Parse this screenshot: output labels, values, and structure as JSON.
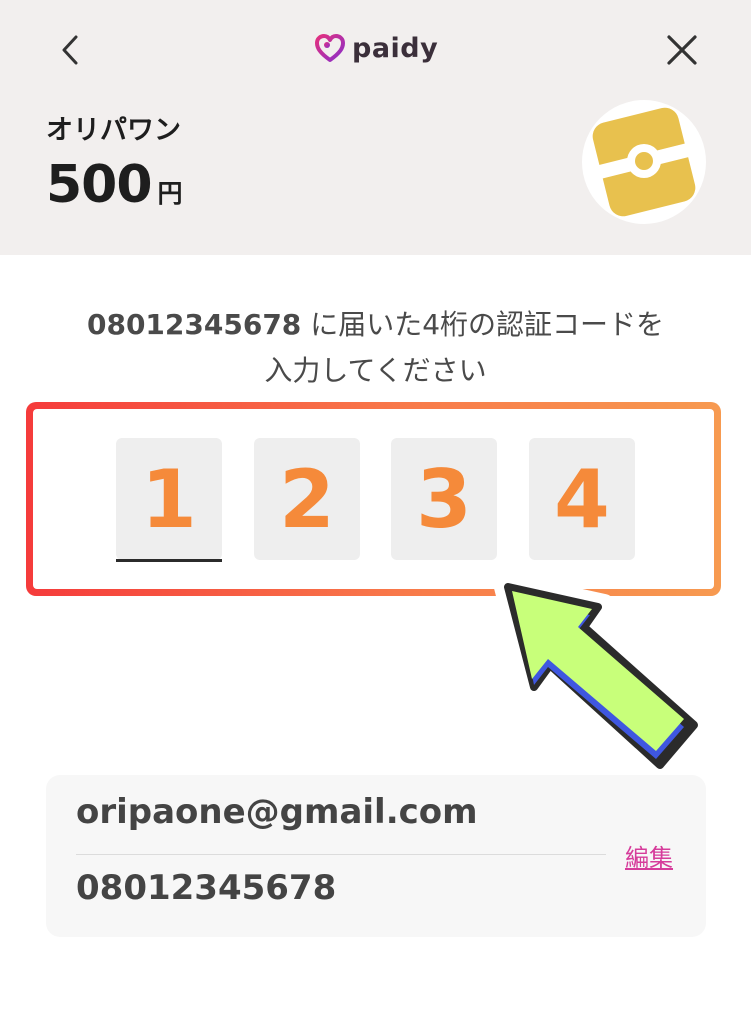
{
  "header": {
    "brand": "paidy",
    "merchant_name": "オリパワン",
    "amount": "500",
    "currency": "円",
    "back_icon": "chevron-left-icon",
    "close_icon": "close-icon"
  },
  "verification": {
    "phone": "08012345678",
    "instruction_rest": " に届いた4桁の認証コードを",
    "instruction_line2": "入力してください",
    "code_digits": [
      "1",
      "2",
      "3",
      "4"
    ]
  },
  "account": {
    "email": "oripaone@gmail.com",
    "phone": "08012345678",
    "edit_label": "編集"
  },
  "colors": {
    "accent_pink": "#d63c9b",
    "digit_orange": "#f58a3a",
    "header_bg": "#f2efee",
    "arrow_green": "#c8ff7a"
  }
}
